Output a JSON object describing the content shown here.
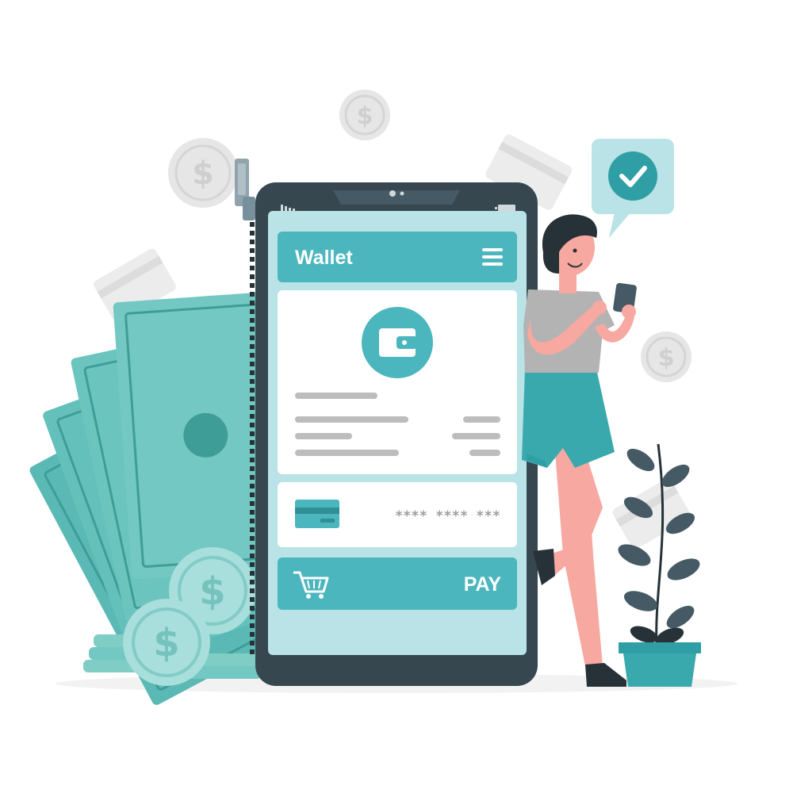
{
  "wallet_app": {
    "header_title": "Wallet",
    "menu_icon": "hamburger-menu-icon",
    "wallet_icon": "wallet-icon",
    "card_icon": "credit-card-icon",
    "card_number_masked": "**** **** ***",
    "cart_icon": "shopping-cart-icon",
    "pay_label": "PAY"
  },
  "notification": {
    "icon": "checkmark-icon"
  },
  "colors": {
    "primary": "#4bb6bd",
    "primary_dark": "#2f9ea5",
    "screen_bg": "#b9e3e6",
    "phone_frame": "#37474f",
    "money_green": "#5ab9b4",
    "coin_gray": "#e6e6e6",
    "skin": "#f7a8a0",
    "shirt": "#b3b3b3",
    "shorts": "#3aa9ad",
    "plant_leaf": "#455a64",
    "pot": "#3aa9ad"
  }
}
